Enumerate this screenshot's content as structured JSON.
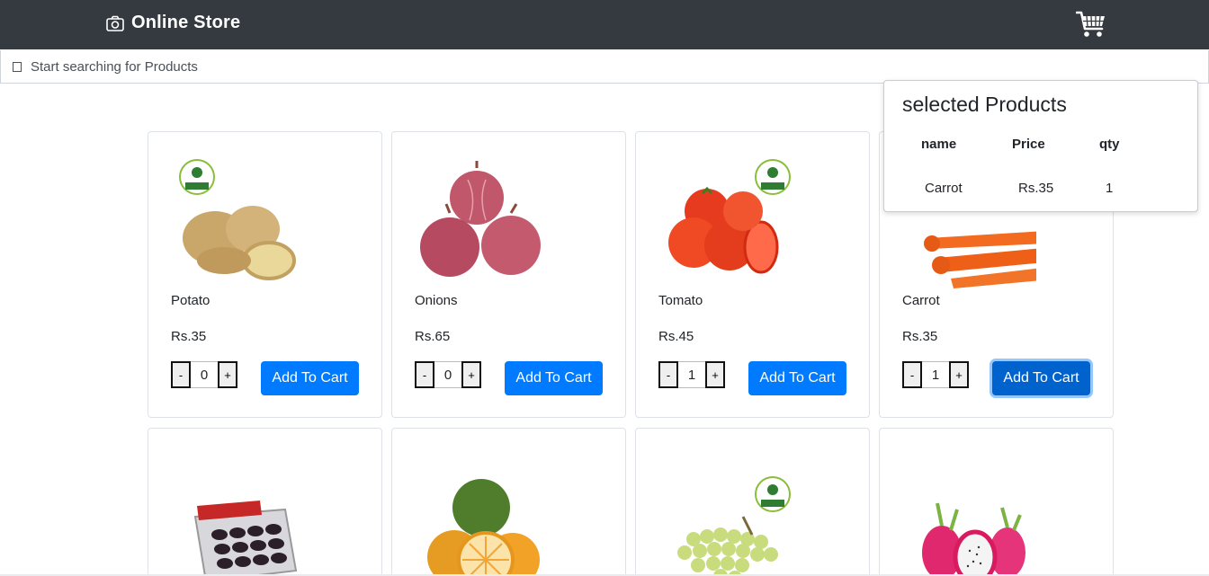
{
  "app": {
    "title": "Online Store",
    "brand_icon": "camera-icon",
    "cart_icon": "shopping-cart-icon"
  },
  "search": {
    "placeholder": "Start searching for Products"
  },
  "products": [
    {
      "name": "Potato",
      "price": "Rs.35",
      "qty": "0",
      "add_label": "Add To Cart",
      "minus": "-",
      "plus": "+"
    },
    {
      "name": "Onions",
      "price": "Rs.65",
      "qty": "0",
      "add_label": "Add To Cart",
      "minus": "-",
      "plus": "+"
    },
    {
      "name": "Tomato",
      "price": "Rs.45",
      "qty": "1",
      "add_label": "Add To Cart",
      "minus": "-",
      "plus": "+"
    },
    {
      "name": "Carrot",
      "price": "Rs.35",
      "qty": "1",
      "add_label": "Add To Cart",
      "minus": "-",
      "plus": "+"
    },
    {
      "image": "dates-pack"
    },
    {
      "image": "oranges"
    },
    {
      "image": "grapes"
    },
    {
      "image": "dragon-fruit"
    }
  ],
  "selected_panel": {
    "title": "selected Products",
    "headers": {
      "name": "name",
      "price": "Price",
      "qty": "qty"
    },
    "rows": [
      {
        "name": "Carrot",
        "price": "Rs.35",
        "qty": "1"
      }
    ]
  },
  "colors": {
    "navbar": "#343a40",
    "primary": "#007bff"
  }
}
